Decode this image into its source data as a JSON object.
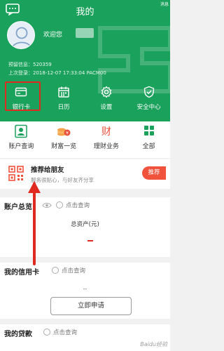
{
  "header": {
    "title": "我的",
    "right_text": "消息",
    "welcome": "欢迎您",
    "reserved_info_label": "预留信息：",
    "reserved_info_value": "520359",
    "last_login_label": "上次登录：",
    "last_login_value": "2018-12-07 17:33:04 PACM00"
  },
  "quick_actions": [
    {
      "label": "银行卡",
      "icon": "bank-card-icon"
    },
    {
      "label": "日历",
      "icon": "calendar-icon"
    },
    {
      "label": "设置",
      "icon": "gear-icon"
    },
    {
      "label": "安全中心",
      "icon": "shield-check-icon"
    }
  ],
  "services": [
    {
      "label": "账户查询",
      "icon": "account-query-icon"
    },
    {
      "label": "财富一览",
      "icon": "wealth-overview-icon"
    },
    {
      "label": "理财业务",
      "icon": "finance-icon",
      "glyph": "财"
    },
    {
      "label": "全部",
      "icon": "grid-icon"
    }
  ],
  "recommend": {
    "title": "推荐给朋友",
    "subtitle": "服务很贴心，与好友齐分享",
    "button": "推荐"
  },
  "account_overview": {
    "title": "账户总览",
    "query": "点击查询",
    "total_label": "总资产(元)"
  },
  "credit_card": {
    "title": "我的信用卡",
    "query": "点击查询",
    "value": "--",
    "apply_button": "立即申请"
  },
  "loan": {
    "title": "我的贷款",
    "query": "点击查询"
  },
  "watermark": "Baidu经验",
  "colors": {
    "brand_green": "#1aa15b",
    "highlight_red": "#e02a20",
    "recommend_orange": "#f0523c"
  }
}
